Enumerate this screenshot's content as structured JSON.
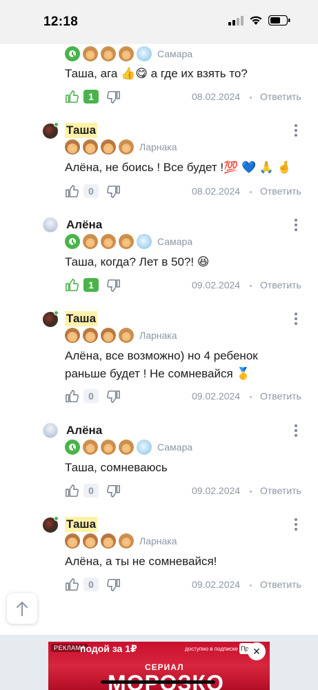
{
  "status_bar": {
    "time": "12:18"
  },
  "comments": [
    {
      "author": "",
      "highlight": false,
      "avatar": "alena",
      "badges": [
        "clock",
        "girl",
        "girl",
        "girl",
        "cloud"
      ],
      "city": "Самара",
      "text": "Таша, ага 👍😋 а где их взять то?",
      "count": "1",
      "count_active": true,
      "date": "08.02.2024",
      "reply": "Ответить"
    },
    {
      "author": "Таша",
      "highlight": true,
      "avatar": "tasha",
      "badges": [
        "boy",
        "boy",
        "boy",
        "girl"
      ],
      "city": "Ларнака",
      "text": "Алёна, не боись ! Все будет !💯 💙 🙏 🤞",
      "count": "0",
      "count_active": false,
      "date": "08.02.2024",
      "reply": "Ответить"
    },
    {
      "author": "Алёна",
      "highlight": false,
      "avatar": "alena",
      "badges": [
        "clock",
        "girl",
        "girl",
        "girl",
        "cloud"
      ],
      "city": "Самара",
      "text": "Таша, когда? Лет в 50?! 😆",
      "count": "1",
      "count_active": true,
      "date": "09.02.2024",
      "reply": "Ответить"
    },
    {
      "author": "Таша",
      "highlight": true,
      "avatar": "tasha",
      "badges": [
        "boy",
        "boy",
        "boy",
        "girl"
      ],
      "city": "Ларнака",
      "text": "Алёна, все возможно) но 4 ребенок раньше будет ! Не сомневайся 🥇",
      "count": "0",
      "count_active": false,
      "date": "09.02.2024",
      "reply": "Ответить"
    },
    {
      "author": "Алёна",
      "highlight": false,
      "avatar": "alena",
      "badges": [
        "clock",
        "girl",
        "girl",
        "girl",
        "cloud"
      ],
      "city": "Самара",
      "text": "Таша, сомневаюсь",
      "count": "0",
      "count_active": false,
      "date": "09.02.2024",
      "reply": "Ответить"
    },
    {
      "author": "Таша",
      "highlight": true,
      "avatar": "tasha",
      "badges": [
        "boy",
        "boy",
        "boy",
        "girl"
      ],
      "city": "Ларнака",
      "text": "Алёна, а ты не сомневайся!",
      "count": "0",
      "count_active": false,
      "date": "09.02.2024",
      "reply": "Ответить"
    }
  ],
  "ad": {
    "label": "РЕКЛАМА",
    "headline": "подой за 1₽",
    "subline": "доступно в подписке",
    "cta": "При",
    "series_label": "СЕРИАЛ",
    "title": "МОРОЗКО"
  },
  "colors": {
    "accent_green": "#4bb34b",
    "muted": "#8d96a3",
    "highlight": "#fdf2a8",
    "ad_red": "#c8102e"
  }
}
